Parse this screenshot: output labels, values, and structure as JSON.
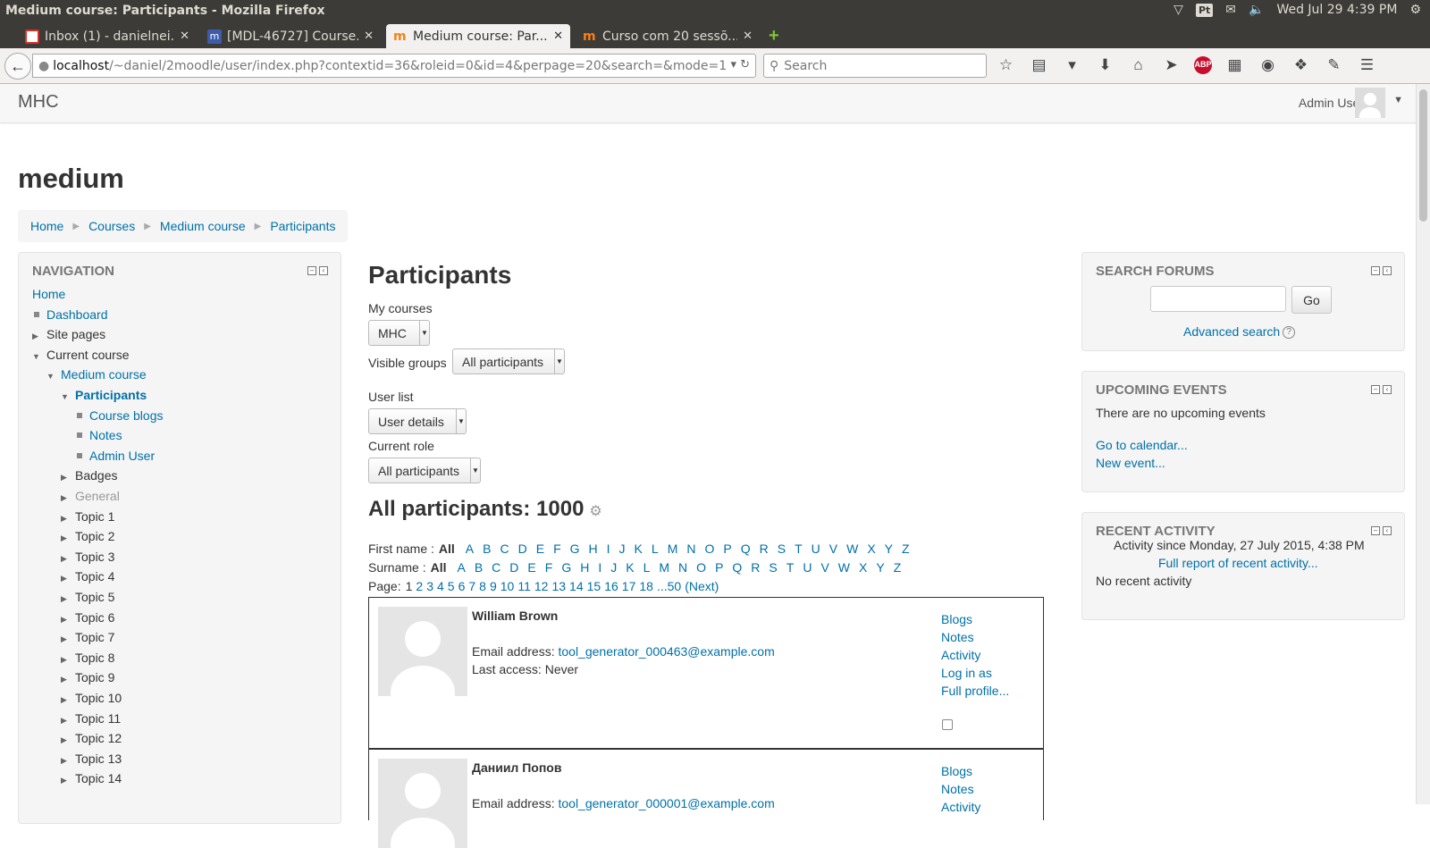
{
  "os": {
    "window_title": "Medium course: Participants - Mozilla Firefox",
    "input_method": "Pt",
    "datetime": "Wed Jul 29  4:39 PM"
  },
  "tabs": [
    {
      "title": "Inbox (1) - danielnei...",
      "icon": "gmail-icon",
      "active": false
    },
    {
      "title": "[MDL-46727] Course...",
      "icon": "jira-icon",
      "active": false
    },
    {
      "title": "Medium course: Par...",
      "icon": "moodle-icon",
      "active": true
    },
    {
      "title": "Curso com 20 sessõ...",
      "icon": "moodle-icon",
      "active": false
    }
  ],
  "toolbar": {
    "url_host": "localhost",
    "url_path": "/~daniel/2moodle/user/index.php?contextid=36&roleid=0&id=4&perpage=20&search=&mode=1",
    "search_placeholder": "Search",
    "icons": [
      "bookmark-star-icon",
      "reading-list-icon",
      "pocket-icon",
      "download-icon",
      "home-icon",
      "send-icon",
      "adblock-icon",
      "grid-icon",
      "chat-icon",
      "extension-icon",
      "tools-icon",
      "menu-icon"
    ],
    "adblock_label": "ABP"
  },
  "site": {
    "brand": "MHC",
    "user_name": "Admin User"
  },
  "course_title": "medium",
  "breadcrumb": [
    "Home",
    "Courses",
    "Medium course",
    "Participants"
  ],
  "navigation": {
    "heading": "NAVIGATION",
    "items": [
      {
        "label": "Home",
        "level": 0,
        "marker": "none",
        "style": "link"
      },
      {
        "label": "Dashboard",
        "level": 1,
        "marker": "bullet",
        "style": "link"
      },
      {
        "label": "Site pages",
        "level": 1,
        "marker": "collapsed",
        "style": "text"
      },
      {
        "label": "Current course",
        "level": 1,
        "marker": "expanded",
        "style": "text"
      },
      {
        "label": "Medium course",
        "level": 2,
        "marker": "expanded",
        "style": "link"
      },
      {
        "label": "Participants",
        "level": 3,
        "marker": "expanded",
        "style": "active"
      },
      {
        "label": "Course blogs",
        "level": 4,
        "marker": "bullet",
        "style": "link"
      },
      {
        "label": "Notes",
        "level": 4,
        "marker": "bullet",
        "style": "link"
      },
      {
        "label": "Admin User",
        "level": 4,
        "marker": "bullet",
        "style": "link"
      },
      {
        "label": "Badges",
        "level": 3,
        "marker": "collapsed",
        "style": "text"
      },
      {
        "label": "General",
        "level": 3,
        "marker": "collapsed",
        "style": "dim"
      },
      {
        "label": "Topic 1",
        "level": 3,
        "marker": "collapsed",
        "style": "text"
      },
      {
        "label": "Topic 2",
        "level": 3,
        "marker": "collapsed",
        "style": "text"
      },
      {
        "label": "Topic 3",
        "level": 3,
        "marker": "collapsed",
        "style": "text"
      },
      {
        "label": "Topic 4",
        "level": 3,
        "marker": "collapsed",
        "style": "text"
      },
      {
        "label": "Topic 5",
        "level": 3,
        "marker": "collapsed",
        "style": "text"
      },
      {
        "label": "Topic 6",
        "level": 3,
        "marker": "collapsed",
        "style": "text"
      },
      {
        "label": "Topic 7",
        "level": 3,
        "marker": "collapsed",
        "style": "text"
      },
      {
        "label": "Topic 8",
        "level": 3,
        "marker": "collapsed",
        "style": "text"
      },
      {
        "label": "Topic 9",
        "level": 3,
        "marker": "collapsed",
        "style": "text"
      },
      {
        "label": "Topic 10",
        "level": 3,
        "marker": "collapsed",
        "style": "text"
      },
      {
        "label": "Topic 11",
        "level": 3,
        "marker": "collapsed",
        "style": "text"
      },
      {
        "label": "Topic 12",
        "level": 3,
        "marker": "collapsed",
        "style": "text"
      },
      {
        "label": "Topic 13",
        "level": 3,
        "marker": "collapsed",
        "style": "text"
      },
      {
        "label": "Topic 14",
        "level": 3,
        "marker": "collapsed",
        "style": "text"
      }
    ]
  },
  "main": {
    "title": "Participants",
    "my_courses_label": "My courses",
    "my_courses_value": "MHC",
    "visible_groups_label": "Visible groups",
    "visible_groups_value": "All participants",
    "user_list_label": "User list",
    "user_list_value": "User details",
    "current_role_label": "Current role",
    "current_role_value": "All participants",
    "count_heading": "All participants: 1000",
    "firstname_label": "First name :",
    "surname_label": "Surname :",
    "letters": [
      "All",
      "A",
      "B",
      "C",
      "D",
      "E",
      "F",
      "G",
      "H",
      "I",
      "J",
      "K",
      "L",
      "M",
      "N",
      "O",
      "P",
      "Q",
      "R",
      "S",
      "T",
      "U",
      "V",
      "W",
      "X",
      "Y",
      "Z"
    ],
    "page_label": "Page:",
    "pages": [
      "1",
      "2",
      "3",
      "4",
      "5",
      "6",
      "7",
      "8",
      "9",
      "10",
      "11",
      "12",
      "13",
      "14",
      "15",
      "16",
      "17",
      "18"
    ],
    "pages_more": "...50",
    "next_label": "(Next)",
    "participants": [
      {
        "name": "William Brown",
        "email_label": "Email address:",
        "email": "tool_generator_000463@example.com",
        "last_access": "Last access: Never",
        "links": [
          "Blogs",
          "Notes",
          "Activity",
          "Log in as",
          "Full profile..."
        ]
      },
      {
        "name": "Даниил Попов",
        "email_label": "Email address:",
        "email": "tool_generator_000001@example.com",
        "links": [
          "Blogs",
          "Notes",
          "Activity"
        ]
      }
    ]
  },
  "search_forums": {
    "heading": "SEARCH FORUMS",
    "go_label": "Go",
    "advanced_label": "Advanced search"
  },
  "upcoming_events": {
    "heading": "UPCOMING EVENTS",
    "empty_text": "There are no upcoming events",
    "calendar_link": "Go to calendar...",
    "new_event_link": "New event..."
  },
  "recent_activity": {
    "heading": "RECENT ACTIVITY",
    "since_text": "Activity since Monday, 27 July 2015, 4:38 PM",
    "full_report_link": "Full report of recent activity...",
    "empty_text": "No recent activity"
  }
}
